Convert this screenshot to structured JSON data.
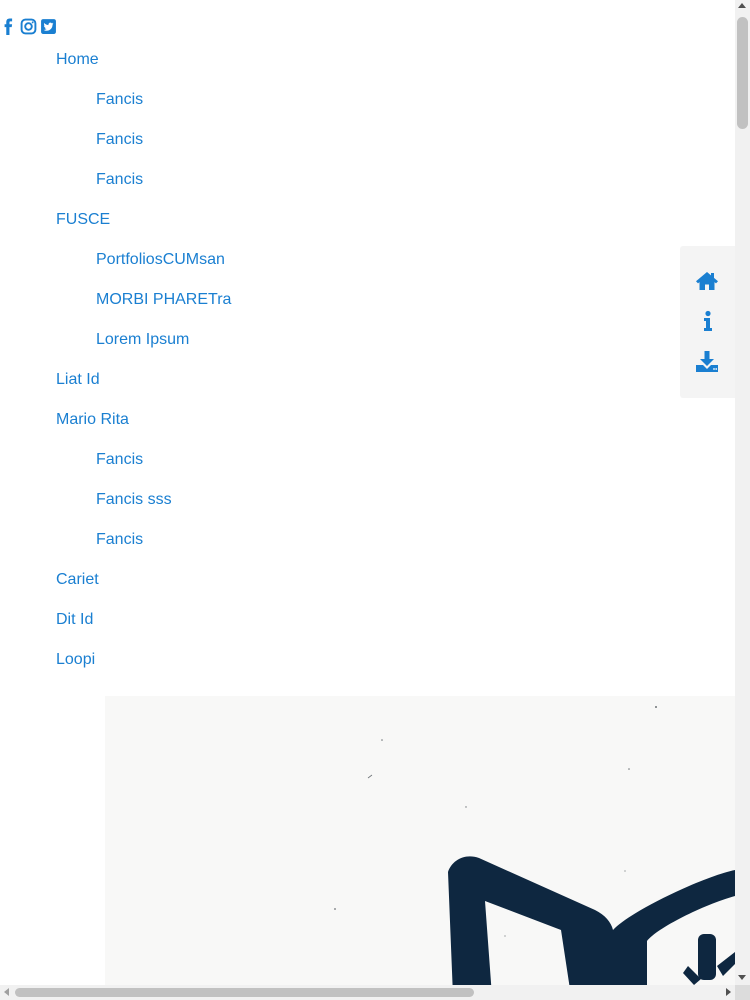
{
  "social": {
    "icons": [
      "facebook-icon",
      "instagram-icon",
      "twitter-icon"
    ],
    "color": "#1a7fd1"
  },
  "nav": {
    "items": [
      {
        "label": "Home",
        "children": [
          "Fancis",
          "Fancis",
          "Fancis"
        ]
      },
      {
        "label": "FUSCE",
        "children": [
          "PortfoliosCUMsan",
          "MORBI PHARETra",
          "Lorem Ipsum"
        ]
      },
      {
        "label": "Liat Id",
        "children": []
      },
      {
        "label": "Mario Rita",
        "children": [
          "Fancis",
          "Fancis sss",
          "Fancis"
        ]
      },
      {
        "label": "Cariet",
        "children": []
      },
      {
        "label": "Dit Id",
        "children": []
      },
      {
        "label": "Loopi",
        "children": []
      }
    ],
    "link_color": "#1a7fd1"
  },
  "side_panel": {
    "icons": [
      "home-icon",
      "info-icon",
      "download-icon"
    ],
    "background": "#f4f4f4",
    "icon_color": "#1a7fd1"
  },
  "hero": {
    "image": "book-logo-photo",
    "logo_color": "#0e2740"
  }
}
